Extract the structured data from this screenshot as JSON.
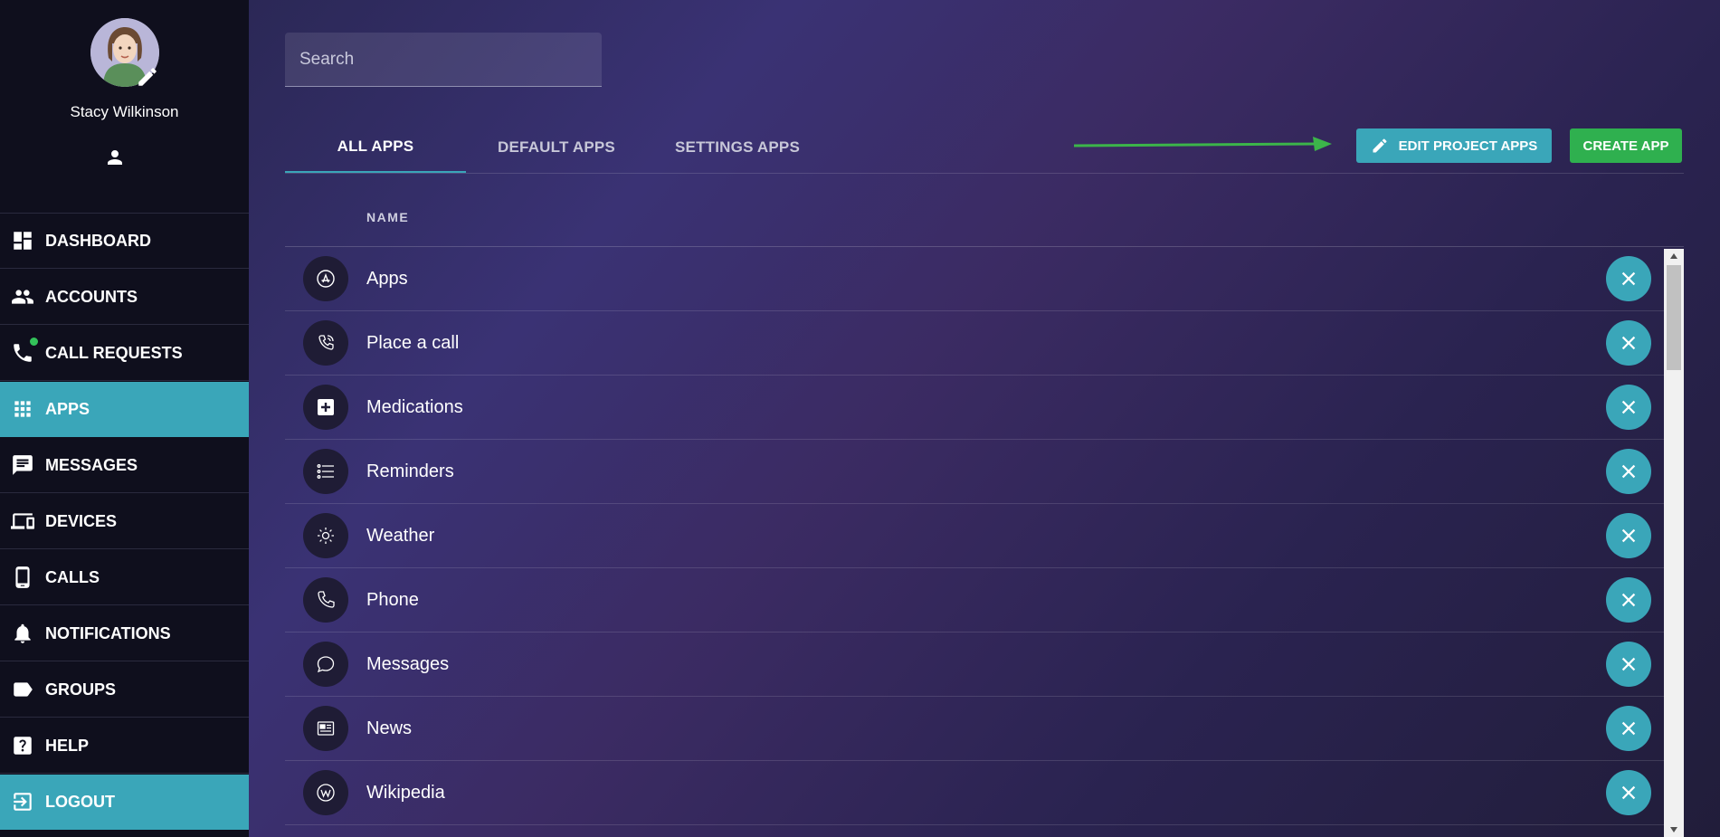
{
  "user": {
    "name": "Stacy Wilkinson"
  },
  "nav": [
    {
      "label": "DASHBOARD",
      "icon": "dashboard-icon"
    },
    {
      "label": "ACCOUNTS",
      "icon": "people-icon"
    },
    {
      "label": "CALL REQUESTS",
      "icon": "phone-icon",
      "badge": true
    },
    {
      "label": "APPS",
      "icon": "apps-grid-icon",
      "active": true
    },
    {
      "label": "MESSAGES",
      "icon": "message-icon"
    },
    {
      "label": "DEVICES",
      "icon": "devices-icon"
    },
    {
      "label": "CALLS",
      "icon": "mobile-icon"
    },
    {
      "label": "NOTIFICATIONS",
      "icon": "bell-icon"
    },
    {
      "label": "GROUPS",
      "icon": "label-icon"
    },
    {
      "label": "HELP",
      "icon": "help-icon"
    },
    {
      "label": "LOGOUT",
      "icon": "logout-icon",
      "active": true
    }
  ],
  "search": {
    "placeholder": "Search"
  },
  "tabs": [
    {
      "label": "ALL APPS",
      "active": true
    },
    {
      "label": "DEFAULT APPS"
    },
    {
      "label": "SETTINGS APPS"
    }
  ],
  "actions": {
    "edit_label": "EDIT PROJECT APPS",
    "create_label": "CREATE APP"
  },
  "table": {
    "column_name": "NAME",
    "rows": [
      {
        "label": "Apps",
        "icon": "app-store-icon"
      },
      {
        "label": "Place a call",
        "icon": "phone-call-icon"
      },
      {
        "label": "Medications",
        "icon": "medical-plus-icon"
      },
      {
        "label": "Reminders",
        "icon": "list-icon"
      },
      {
        "label": "Weather",
        "icon": "sun-icon"
      },
      {
        "label": "Phone",
        "icon": "phone-outline-icon"
      },
      {
        "label": "Messages",
        "icon": "chat-bubble-icon"
      },
      {
        "label": "News",
        "icon": "newspaper-icon"
      },
      {
        "label": "Wikipedia",
        "icon": "wikipedia-icon"
      }
    ]
  },
  "colors": {
    "accent": "#3aa6b9",
    "create": "#2fb04f",
    "sidebar": "#0f0f1d",
    "arrow": "#3cb54a"
  }
}
